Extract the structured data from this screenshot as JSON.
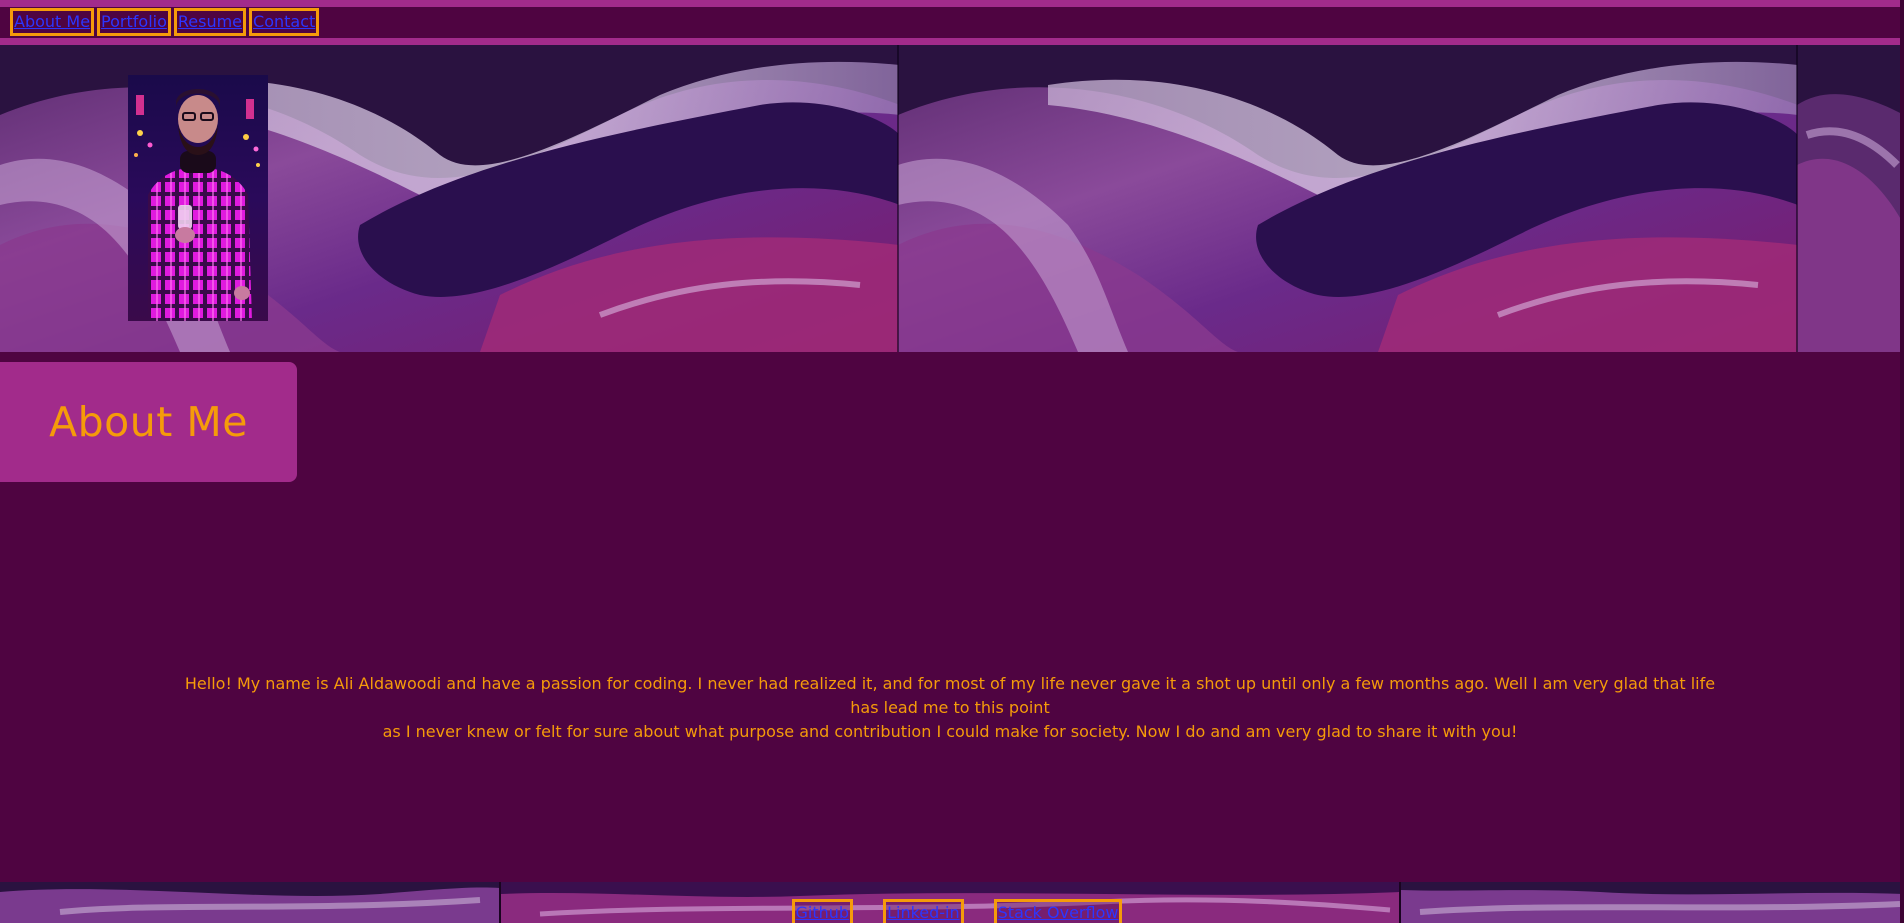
{
  "nav": {
    "items": [
      {
        "label": "About Me"
      },
      {
        "label": "Portfolio"
      },
      {
        "label": "Resume"
      },
      {
        "label": "Contact"
      }
    ]
  },
  "hero": {
    "image": "purple-glitter-marble-banner",
    "profile_image": "profile-photo-man-plaid-shirt"
  },
  "about": {
    "title": "About Me",
    "bio_line1": "Hello! My name is Ali Aldawoodi and have a passion for coding. I never had realized it, and for most of my life never gave it a shot up until only a few months ago. Well I am very glad that life has lead me to this point",
    "bio_line2": "as I never knew or felt for sure about what purpose and contribution I could make for society. Now I do and am very glad to share it with you!"
  },
  "footer": {
    "links": [
      {
        "label": "Github"
      },
      {
        "label": "Linked-in"
      },
      {
        "label": "Stack Overflow"
      }
    ]
  },
  "colors": {
    "background": "#4f0441",
    "accent_pink": "#a22b8b",
    "accent_orange": "#f59b0a",
    "link_blue": "#2c36ff"
  }
}
